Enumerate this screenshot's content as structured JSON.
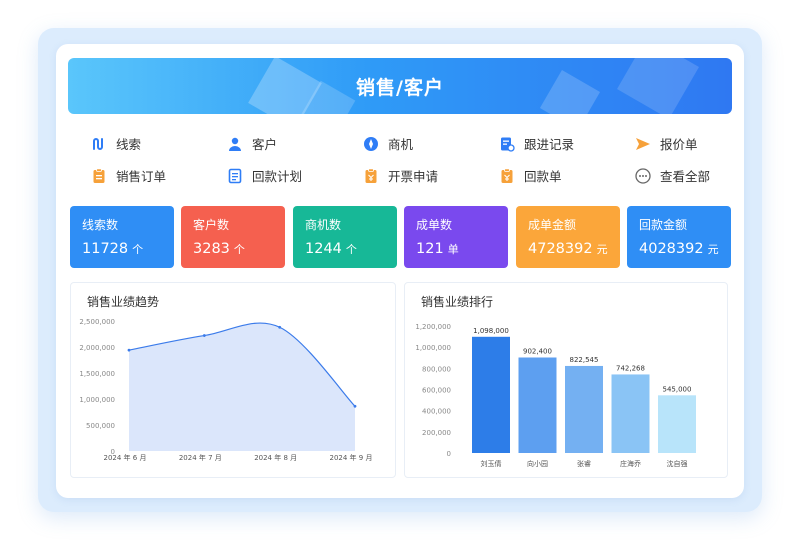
{
  "banner": {
    "title": "销售/客户"
  },
  "quick_links": [
    {
      "label": "线索",
      "icon": "path-icon",
      "color": "#2f7df6"
    },
    {
      "label": "客户",
      "icon": "user-icon",
      "color": "#2f7df6"
    },
    {
      "label": "商机",
      "icon": "compass-icon",
      "color": "#2f7df6"
    },
    {
      "label": "跟进记录",
      "icon": "record-icon",
      "color": "#2f7df6"
    },
    {
      "label": "报价单",
      "icon": "send-icon",
      "color": "#f6a13a"
    },
    {
      "label": "销售订单",
      "icon": "clipboard-icon",
      "color": "#f6a13a"
    },
    {
      "label": "回款计划",
      "icon": "document-icon",
      "color": "#2f7df6"
    },
    {
      "label": "开票申请",
      "icon": "invoice-icon",
      "color": "#f6a13a"
    },
    {
      "label": "回款单",
      "icon": "receipt-icon",
      "color": "#f6a13a"
    },
    {
      "label": "查看全部",
      "icon": "more-icon",
      "color": "#666666"
    }
  ],
  "stats": [
    {
      "label": "线索数",
      "value": "11728",
      "unit": "个",
      "color": "#2f8ef5"
    },
    {
      "label": "客户数",
      "value": "3283",
      "unit": "个",
      "color": "#f5604f"
    },
    {
      "label": "商机数",
      "value": "1244",
      "unit": "个",
      "color": "#17b897"
    },
    {
      "label": "成单数",
      "value": "121",
      "unit": "单",
      "color": "#7a49ee"
    },
    {
      "label": "成单金额",
      "value": "4728392",
      "unit": "元",
      "color": "#fba63a"
    },
    {
      "label": "回款金额",
      "value": "4028392",
      "unit": "元",
      "color": "#2f8ef5"
    }
  ],
  "chart_data": [
    {
      "type": "area",
      "title": "销售业绩趋势",
      "categories": [
        "2024 年 6 月",
        "2024 年 7 月",
        "2024 年 8 月",
        "2024 年 9 月"
      ],
      "x_positions": [
        0,
        1,
        2,
        3
      ],
      "points": [
        {
          "x": 0,
          "y": 1940000
        },
        {
          "x": 1,
          "y": 2220000
        },
        {
          "x": 2,
          "y": 2380000
        },
        {
          "x": 3,
          "y": 860000
        }
      ],
      "ylim": [
        0,
        2500000
      ],
      "yticks": [
        0,
        500000,
        1000000,
        1500000,
        2000000,
        2500000
      ],
      "ytick_labels": [
        "0",
        "500,000",
        "1,000,000",
        "1,500,000",
        "2,000,000",
        "2,500,000"
      ],
      "grid": false,
      "fill_color": "#dbe6fb",
      "line_color": "#3b7bea"
    },
    {
      "type": "bar",
      "title": "销售业绩排行",
      "categories": [
        "刘玉倩",
        "向小园",
        "张睿",
        "庄海乔",
        "沈自强"
      ],
      "values": [
        1098000,
        902400,
        822545,
        742268,
        545000
      ],
      "value_labels": [
        "1,098,000",
        "902,400",
        "822,545",
        "742,268",
        "545,000"
      ],
      "colors": [
        "#2d7de8",
        "#5d9ff0",
        "#74b0f2",
        "#8ac4f5",
        "#b8e4fa"
      ],
      "ylim": [
        0,
        1200000
      ],
      "yticks": [
        0,
        200000,
        400000,
        600000,
        800000,
        1000000,
        1200000
      ],
      "ytick_labels": [
        "0",
        "200,000",
        "400,000",
        "600,000",
        "800,000",
        "1,000,000",
        "1,200,000"
      ],
      "grid": false
    }
  ]
}
